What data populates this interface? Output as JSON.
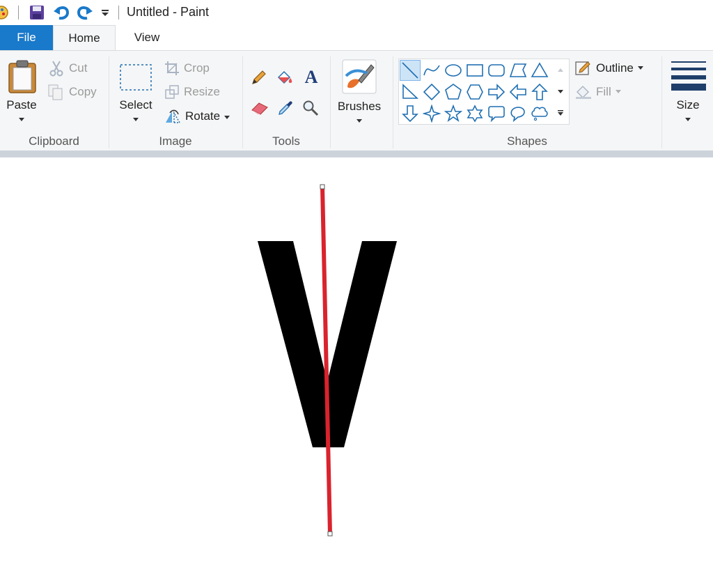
{
  "window": {
    "title": "Untitled - Paint"
  },
  "tabs": {
    "file": "File",
    "home": "Home",
    "view": "View"
  },
  "clipboard": {
    "paste": "Paste",
    "cut": "Cut",
    "copy": "Copy",
    "group": "Clipboard"
  },
  "image": {
    "select": "Select",
    "crop": "Crop",
    "resize": "Resize",
    "rotate": "Rotate",
    "group": "Image"
  },
  "tools": {
    "group": "Tools",
    "items": [
      "pencil-icon",
      "fill-bucket-icon",
      "text-icon",
      "eraser-icon",
      "color-picker-icon",
      "magnifier-icon"
    ]
  },
  "brushes": {
    "label": "Brushes"
  },
  "shapes": {
    "group": "Shapes",
    "outline": "Outline",
    "fill": "Fill",
    "selected": "line"
  },
  "size": {
    "label": "Size"
  },
  "canvas": {
    "letter": "V",
    "letter_color": "#000000",
    "line_color": "#d9232d"
  },
  "colors": {
    "accent": "#1979ca",
    "ribbon": "#f5f6f7",
    "shape_stroke": "#1f6fb2"
  }
}
